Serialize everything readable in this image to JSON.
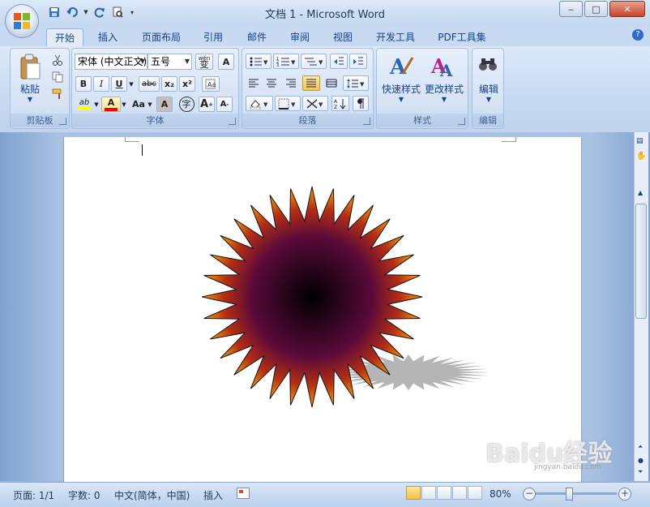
{
  "window": {
    "title": "文档 1 - Microsoft Word",
    "buttons": {
      "minimize": "‒",
      "maximize": "□",
      "close": "✕"
    }
  },
  "ribbon_tabs": [
    "开始",
    "插入",
    "页面布局",
    "引用",
    "邮件",
    "审阅",
    "视图",
    "开发工具",
    "PDF工具集"
  ],
  "active_tab": "开始",
  "groups": {
    "clipboard": {
      "label": "剪贴板",
      "paste": "粘贴"
    },
    "font": {
      "label": "字体",
      "font_name": "宋体 (中文正文)",
      "font_size": "五号",
      "wen_label": "wén",
      "wen_char": "变",
      "char_border": "A",
      "bold": "B",
      "italic": "I",
      "underline": "U",
      "strike": "abc",
      "subscript": "x₂",
      "superscript": "x²",
      "highlight": "ab",
      "font_color": "A",
      "case": "Aa",
      "char_shading": "A",
      "enclose": "字",
      "grow": "A",
      "shrink": "A"
    },
    "paragraph": {
      "label": "段落"
    },
    "styles": {
      "label": "样式",
      "quick_styles": "快速样式",
      "change_styles": "更改样式"
    },
    "editing": {
      "label": "编辑",
      "edit": "编辑"
    }
  },
  "statusbar": {
    "page": "页面: 1/1",
    "words": "字数: 0",
    "language": "中文(简体，中国)",
    "mode": "插入",
    "zoom": "80%"
  },
  "watermark": "Baidu经验",
  "watermark_sub": "jingyan.baidu.com",
  "colors": {
    "gradient_center": "#000000",
    "gradient_mid": "#5a0a3a",
    "gradient_outer": "#ffa000"
  }
}
